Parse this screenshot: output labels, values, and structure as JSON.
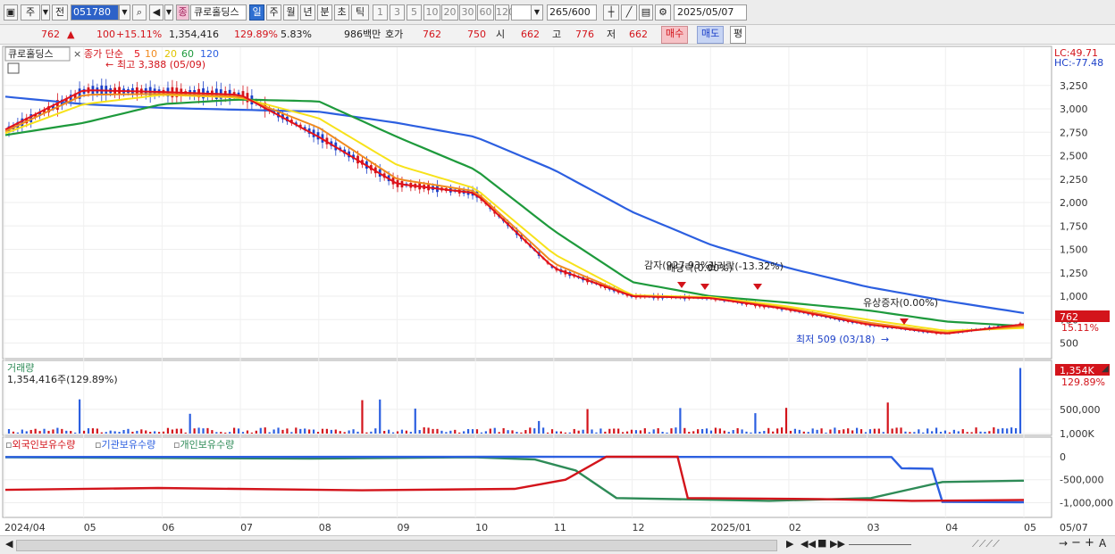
{
  "toolbar": {
    "period_main": "주",
    "prev_label": "전",
    "stock_code": "051780",
    "stock_name": "큐로홀딩스",
    "stock_badge": "종",
    "periods": [
      "일",
      "주",
      "월",
      "년",
      "분",
      "초",
      "틱"
    ],
    "selected_period": "일",
    "intervals": [
      "1",
      "3",
      "5",
      "10",
      "20",
      "30",
      "60",
      "120"
    ],
    "count_value": "265",
    "count_total": "/600",
    "date": "2025/05/07"
  },
  "quote": {
    "price": "762",
    "change": "100",
    "change_pct": "+15.11%",
    "volume": "1,354,416",
    "volume_ratio": "129.89%",
    "turnover": "5.83%",
    "amount": "986백만",
    "bid_label": "호가",
    "ask_price": "762",
    "bid_price": "750",
    "open_label": "시",
    "open": "662",
    "high_label": "고",
    "high": "776",
    "low_label": "저",
    "low": "662",
    "buy_label": "매수",
    "sell_label": "매도",
    "avg_label": "평"
  },
  "price_panel": {
    "title": "큐로홀딩스",
    "ma_label": "종가 단순",
    "ma_periods": [
      "5",
      "10",
      "20",
      "60",
      "120"
    ],
    "ma_colors": [
      "#e3121b",
      "#f08a1e",
      "#f7e21a",
      "#1e9a3c",
      "#2c5fe0"
    ],
    "high_annotation": "최고 3,388 (05/09)",
    "low_annotation": "최저 509 (03/18)",
    "event_1": "감자(927.93%)",
    "event_2": "배당락(0.00%)",
    "event_3": "권리락(-13.32%)",
    "event_4": "유상증자(0.00%)",
    "lc_label": "LC:49.71",
    "hc_label": "HC:-77.48",
    "last_price_tag": "762",
    "last_pct_tag": "15.11%",
    "y_ticks": [
      "3,250",
      "3,000",
      "2,750",
      "2,500",
      "2,250",
      "2,000",
      "1,750",
      "1,500",
      "1,250",
      "1,000",
      "750",
      "500"
    ]
  },
  "volume_panel": {
    "title": "거래량",
    "subtitle": "1,354,416주(129.89%)",
    "tag_value": "1,354K",
    "tag_pct": "129.89%",
    "y_ticks": [
      "1,000K",
      "500,000"
    ]
  },
  "holdings_panel": {
    "series_labels": [
      "외국인보유수량",
      "기관보유수량",
      "개인보유수량"
    ],
    "series_colors": [
      "#d3141b",
      "#2c5fe0",
      "#2e8b57"
    ],
    "y_ticks": [
      "0",
      "-500,000",
      "-1,000,000"
    ]
  },
  "x_axis": {
    "labels": [
      "2024/04",
      "05",
      "06",
      "07",
      "08",
      "09",
      "10",
      "11",
      "12",
      "2025/01",
      "02",
      "03",
      "04",
      "05",
      "05/07"
    ]
  },
  "chart_data": {
    "type": "line",
    "title": "큐로홀딩스",
    "x_labels": [
      "2024/04",
      "05",
      "06",
      "07",
      "08",
      "09",
      "10",
      "11",
      "12",
      "2025/01",
      "02",
      "03",
      "04",
      "05"
    ],
    "series": [
      {
        "name": "5",
        "values": [
          2780,
          3200,
          3180,
          3150,
          2700,
          2200,
          2100,
          1300,
          1000,
          980,
          860,
          700,
          600,
          700
        ]
      },
      {
        "name": "10",
        "values": [
          2760,
          3150,
          3160,
          3130,
          2800,
          2250,
          2120,
          1350,
          1000,
          980,
          870,
          720,
          610,
          680
        ]
      },
      {
        "name": "20",
        "values": [
          2740,
          3050,
          3150,
          3120,
          2900,
          2400,
          2150,
          1450,
          1010,
          990,
          890,
          750,
          630,
          660
        ]
      },
      {
        "name": "60",
        "values": [
          2720,
          2850,
          3050,
          3100,
          3080,
          2700,
          2350,
          1700,
          1150,
          1000,
          930,
          850,
          730,
          680
        ]
      },
      {
        "name": "120",
        "values": [
          3130,
          3050,
          3010,
          2990,
          2970,
          2850,
          2700,
          2350,
          1900,
          1550,
          1300,
          1100,
          950,
          820
        ]
      }
    ],
    "ylim": [
      400,
      3400
    ],
    "grid": true,
    "legend": "top-left"
  }
}
